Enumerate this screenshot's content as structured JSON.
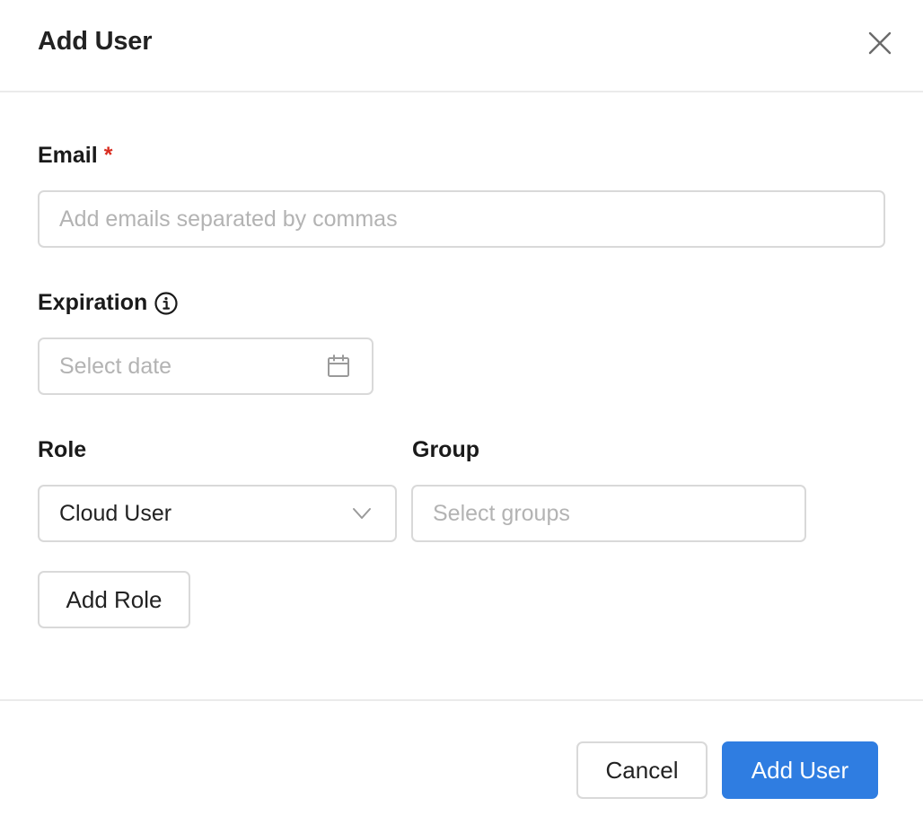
{
  "dialog": {
    "title": "Add User"
  },
  "form": {
    "email": {
      "label": "Email",
      "required_mark": "*",
      "placeholder": "Add emails separated by commas",
      "value": ""
    },
    "expiration": {
      "label": "Expiration",
      "placeholder": "Select date",
      "value": ""
    },
    "role": {
      "label": "Role",
      "selected": "Cloud User"
    },
    "group": {
      "label": "Group",
      "placeholder": "Select groups"
    },
    "add_role_label": "Add Role"
  },
  "footer": {
    "cancel_label": "Cancel",
    "submit_label": "Add User"
  },
  "colors": {
    "primary": "#2f7de1",
    "required": "#d92d20",
    "border": "#d9d9d9",
    "placeholder": "#b3b3b3"
  },
  "icons": {
    "close": "close-icon",
    "info": "info-icon",
    "calendar": "calendar-icon",
    "dropdown": "chevron-down-icon"
  }
}
